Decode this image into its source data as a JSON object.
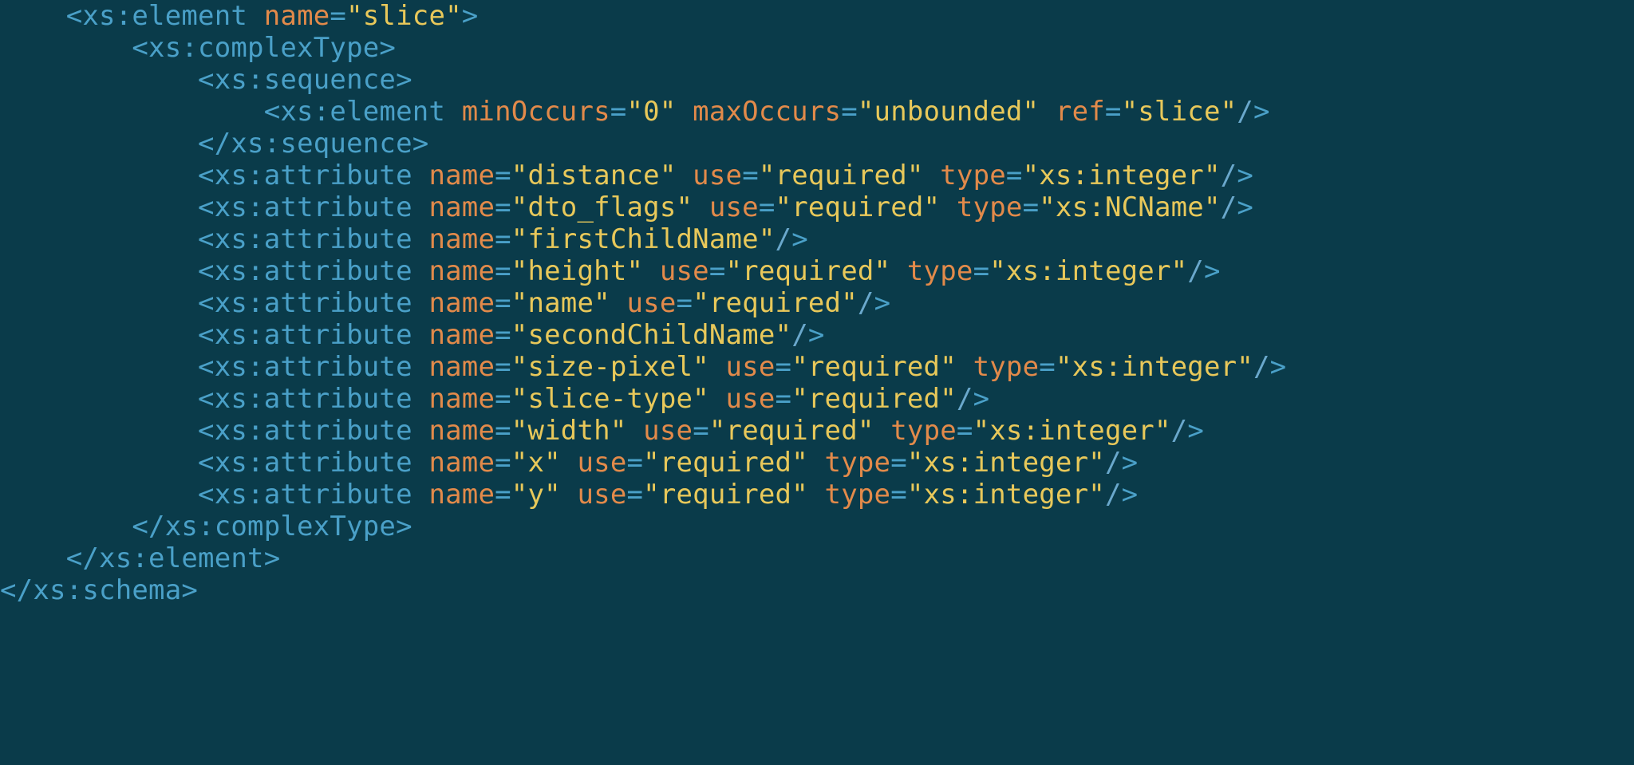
{
  "colors": {
    "background": "#0a3b4a",
    "tag": "#4aa0c8",
    "attribute": "#e28a4a",
    "string": "#e8c85a"
  },
  "code": {
    "indent_unit": "    ",
    "lines": [
      {
        "indent": 1,
        "kind": "open",
        "tag": "xs:element",
        "attrs": [
          {
            "name": "name",
            "value": "slice"
          }
        ]
      },
      {
        "indent": 2,
        "kind": "open",
        "tag": "xs:complexType",
        "attrs": []
      },
      {
        "indent": 3,
        "kind": "open",
        "tag": "xs:sequence",
        "attrs": []
      },
      {
        "indent": 4,
        "kind": "self",
        "tag": "xs:element",
        "attrs": [
          {
            "name": "minOccurs",
            "value": "0"
          },
          {
            "name": "maxOccurs",
            "value": "unbounded"
          },
          {
            "name": "ref",
            "value": "slice"
          }
        ]
      },
      {
        "indent": 3,
        "kind": "close",
        "tag": "xs:sequence"
      },
      {
        "indent": 3,
        "kind": "self",
        "tag": "xs:attribute",
        "attrs": [
          {
            "name": "name",
            "value": "distance"
          },
          {
            "name": "use",
            "value": "required"
          },
          {
            "name": "type",
            "value": "xs:integer"
          }
        ]
      },
      {
        "indent": 3,
        "kind": "self",
        "tag": "xs:attribute",
        "attrs": [
          {
            "name": "name",
            "value": "dto_flags"
          },
          {
            "name": "use",
            "value": "required"
          },
          {
            "name": "type",
            "value": "xs:NCName"
          }
        ]
      },
      {
        "indent": 3,
        "kind": "self",
        "tag": "xs:attribute",
        "attrs": [
          {
            "name": "name",
            "value": "firstChildName"
          }
        ]
      },
      {
        "indent": 3,
        "kind": "self",
        "tag": "xs:attribute",
        "attrs": [
          {
            "name": "name",
            "value": "height"
          },
          {
            "name": "use",
            "value": "required"
          },
          {
            "name": "type",
            "value": "xs:integer"
          }
        ]
      },
      {
        "indent": 3,
        "kind": "self",
        "tag": "xs:attribute",
        "attrs": [
          {
            "name": "name",
            "value": "name"
          },
          {
            "name": "use",
            "value": "required"
          }
        ]
      },
      {
        "indent": 3,
        "kind": "self",
        "tag": "xs:attribute",
        "attrs": [
          {
            "name": "name",
            "value": "secondChildName"
          }
        ]
      },
      {
        "indent": 3,
        "kind": "self",
        "tag": "xs:attribute",
        "attrs": [
          {
            "name": "name",
            "value": "size-pixel"
          },
          {
            "name": "use",
            "value": "required"
          },
          {
            "name": "type",
            "value": "xs:integer"
          }
        ]
      },
      {
        "indent": 3,
        "kind": "self",
        "tag": "xs:attribute",
        "attrs": [
          {
            "name": "name",
            "value": "slice-type"
          },
          {
            "name": "use",
            "value": "required"
          }
        ]
      },
      {
        "indent": 3,
        "kind": "self",
        "tag": "xs:attribute",
        "attrs": [
          {
            "name": "name",
            "value": "width"
          },
          {
            "name": "use",
            "value": "required"
          },
          {
            "name": "type",
            "value": "xs:integer"
          }
        ]
      },
      {
        "indent": 3,
        "kind": "self",
        "tag": "xs:attribute",
        "attrs": [
          {
            "name": "name",
            "value": "x"
          },
          {
            "name": "use",
            "value": "required"
          },
          {
            "name": "type",
            "value": "xs:integer"
          }
        ]
      },
      {
        "indent": 3,
        "kind": "self",
        "tag": "xs:attribute",
        "attrs": [
          {
            "name": "name",
            "value": "y"
          },
          {
            "name": "use",
            "value": "required"
          },
          {
            "name": "type",
            "value": "xs:integer"
          }
        ]
      },
      {
        "indent": 2,
        "kind": "close",
        "tag": "xs:complexType"
      },
      {
        "indent": 1,
        "kind": "close",
        "tag": "xs:element"
      },
      {
        "indent": 0,
        "kind": "close",
        "tag": "xs:schema"
      }
    ]
  }
}
